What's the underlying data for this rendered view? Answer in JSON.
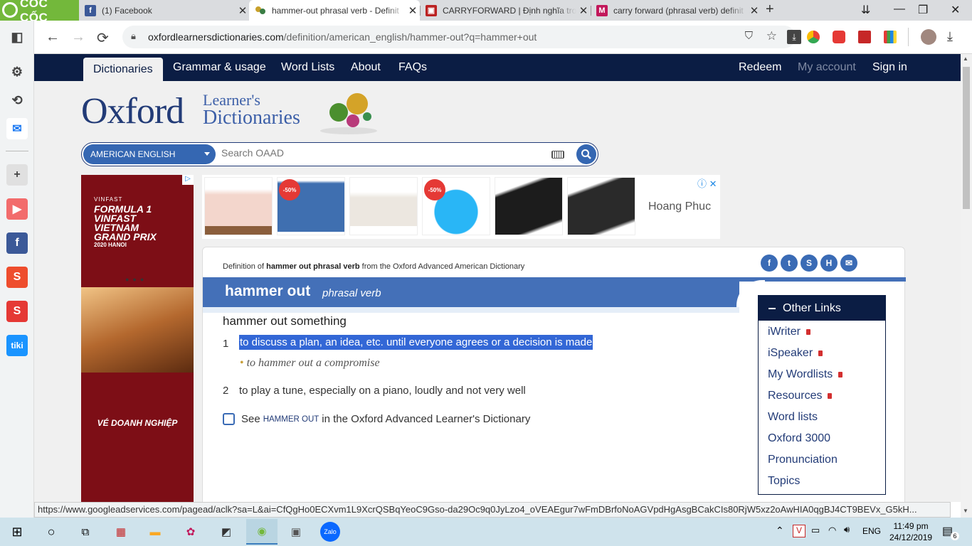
{
  "browser": {
    "brand": "CỐC CỐC",
    "tabs": [
      {
        "title": "(1) Facebook",
        "favicon": "facebook-icon"
      },
      {
        "title": "hammer-out phrasal verb - Definit",
        "favicon": "oxford-icon"
      },
      {
        "title": "CARRYFORWARD | Định nghĩa tron",
        "favicon": "cambridge-icon"
      },
      {
        "title": "carry forward (phrasal verb) definit",
        "favicon": "macmillan-icon"
      }
    ],
    "url_host": "oxfordlearnersdictionaries.com",
    "url_path": "/definition/american_english/hammer-out?q=hammer+out",
    "new_tab": "+"
  },
  "site": {
    "nav_left": [
      "Dictionaries",
      "Grammar & usage",
      "Word Lists",
      "About",
      "FAQs"
    ],
    "nav_right": [
      "Redeem",
      "My account",
      "Sign in"
    ],
    "logo_oxford": "Oxford",
    "logo_line1": "Learner's",
    "logo_line2": "Dictionaries",
    "dict_select": "AMERICAN ENGLISH",
    "search_placeholder": "Search OAAD"
  },
  "ads": {
    "left_title": "FORMULA 1 VINFAST VIETNAM GRAND PRIX",
    "left_sub": "2020 HANOI",
    "left_brand": "VINFAST",
    "left_cta": "VÉ DOANH NGHIỆP",
    "sale1": "-50%",
    "sale2": "-50%",
    "strip_brand": "Hoang Phuc"
  },
  "entry": {
    "def_prefix": "Definition of ",
    "def_word": "hammer out phrasal verb",
    "def_suffix": " from the Oxford Advanced American Dictionary",
    "headword": "hammer out",
    "pos": "phrasal verb",
    "idiom": "hammer out something",
    "senses": [
      {
        "num": "1",
        "text": "to discuss a plan, an idea, etc. until everyone agrees or a decision is made"
      },
      {
        "num": "2",
        "text": "to play a tune, especially on a piano, loudly and not very well"
      }
    ],
    "example": "to hammer out a compromise",
    "see_prefix": "See",
    "see_word": "hammer out",
    "see_suffix": "in the Oxford Advanced Learner's Dictionary"
  },
  "other_links": {
    "title": "Other Links",
    "items": [
      {
        "label": "iWriter",
        "locked": true
      },
      {
        "label": "iSpeaker",
        "locked": true
      },
      {
        "label": "My Wordlists",
        "locked": true
      },
      {
        "label": "Resources",
        "locked": true
      },
      {
        "label": "Word lists",
        "locked": false
      },
      {
        "label": "Oxford 3000",
        "locked": false
      },
      {
        "label": "Pronunciation",
        "locked": false
      },
      {
        "label": "Topics",
        "locked": false
      }
    ]
  },
  "status_url": "https://www.googleadservices.com/pagead/aclk?sa=L&ai=CfQgHo0ECXvm1L9XcrQSBqYeoC9Gso-da29Oc9q0JyLzo4_oVEAEgur7wFmDBrfoNoAGVpdHgAsgBCakCIs80RjW5xz2oAwHIA0qgBJ4CT9BEVx_G5kH...",
  "taskbar": {
    "lang": "ENG",
    "time": "11:49 pm",
    "date": "24/12/2019",
    "notif": "6"
  },
  "colors": {
    "oxford_navy": "#0b1d44",
    "oxford_blue": "#4470b8",
    "highlight": "#3367d6"
  }
}
